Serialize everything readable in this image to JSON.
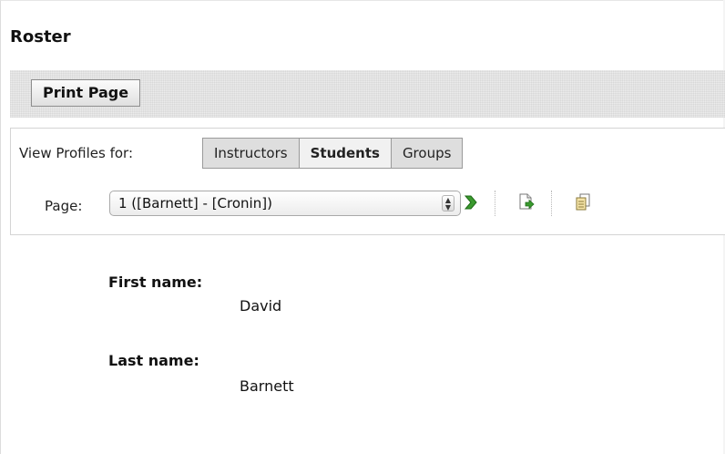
{
  "page": {
    "title": "Roster"
  },
  "toolbar": {
    "print_label": "Print Page"
  },
  "profiles": {
    "view_label": "View Profiles for:",
    "tabs": [
      {
        "label": "Instructors",
        "active": false
      },
      {
        "label": "Students",
        "active": true
      },
      {
        "label": "Groups",
        "active": false
      }
    ],
    "page_label": "Page:",
    "page_selected": "1 ([Barnett] - [Cronin])",
    "icons": [
      "go-arrow-icon",
      "export-page-icon",
      "copy-icon"
    ]
  },
  "student": {
    "first_name_label": "First name:",
    "first_name": "David",
    "last_name_label": "Last name:",
    "last_name": "Barnett"
  },
  "colors": {
    "go_arrow": "#3a9a2e",
    "tab_active_bg": "#f1f1f1",
    "tab_bg": "#dedede"
  }
}
